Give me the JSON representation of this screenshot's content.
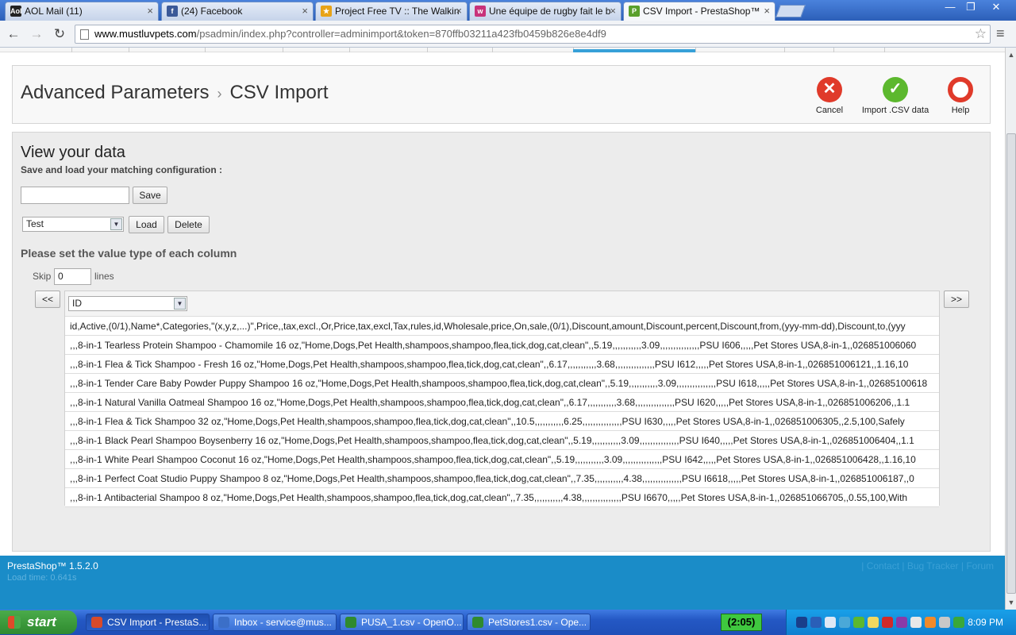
{
  "browser": {
    "tabs": [
      {
        "title": "AOL Mail (11)",
        "favicon": "aol-icon",
        "color": "#222222",
        "glyph": "Aol"
      },
      {
        "title": "(24) Facebook",
        "favicon": "facebook-icon",
        "color": "#3b5998",
        "glyph": "f"
      },
      {
        "title": "Project Free TV :: The Walkin",
        "favicon": "projectfreetv-icon",
        "color": "#e8a317",
        "glyph": "★"
      },
      {
        "title": "Une équipe de rugby fait le b",
        "favicon": "wizz-icon",
        "color": "#c8327a",
        "glyph": "w"
      },
      {
        "title": "CSV Import - PrestaShop™",
        "favicon": "prestashop-icon",
        "color": "#5aa02c",
        "glyph": "P"
      }
    ],
    "url_domain": "www.mustluvpets.com",
    "url_path": "/psadmin/index.php?controller=adminimport&token=870ffb03211a423fb0459b826e8e4df9"
  },
  "header": {
    "breadcrumb_parent": "Advanced Parameters",
    "breadcrumb_current": "CSV Import",
    "cancel_label": "Cancel",
    "import_label": "Import .CSV data",
    "help_label": "Help"
  },
  "content": {
    "title": "View your data",
    "save_config_label": "Save and load your matching configuration :",
    "save_button": "Save",
    "config_selected": "Test",
    "load_button": "Load",
    "delete_button": "Delete",
    "section_title": "Please set the value type of each column",
    "skip_label": "Skip",
    "skip_value": "0",
    "lines_label": "lines",
    "prev_button": "<<",
    "next_button": ">>",
    "column_type": "ID",
    "rows": [
      "id,Active,(0/1),Name*,Categories,\"(x,y,z,...)\",Price,,tax,excl.,Or,Price,tax,excl,Tax,rules,id,Wholesale,price,On,sale,(0/1),Discount,amount,Discount,percent,Discount,from,(yyy-mm-dd),Discount,to,(yyy",
      ",,,8-in-1 Tearless Protein Shampoo - Chamomile 16 oz,\"Home,Dogs,Pet Health,shampoos,shampoo,flea,tick,dog,cat,clean\",,5.19,,,,,,,,,,,3.09,,,,,,,,,,,,,,,PSU I606,,,,,Pet Stores USA,8-in-1,,026851006060",
      ",,,8-in-1 Flea & Tick Shampoo - Fresh 16 oz,\"Home,Dogs,Pet Health,shampoos,shampoo,flea,tick,dog,cat,clean\",,6.17,,,,,,,,,,,3.68,,,,,,,,,,,,,,,PSU I612,,,,,Pet Stores USA,8-in-1,,026851006121,,1.16,10",
      ",,,8-in-1 Tender Care Baby Powder Puppy Shampoo 16 oz,\"Home,Dogs,Pet Health,shampoos,shampoo,flea,tick,dog,cat,clean\",,5.19,,,,,,,,,,,3.09,,,,,,,,,,,,,,,PSU I618,,,,,Pet Stores USA,8-in-1,,02685100618",
      ",,,8-in-1 Natural Vanilla Oatmeal Shampoo 16 oz,\"Home,Dogs,Pet Health,shampoos,shampoo,flea,tick,dog,cat,clean\",,6.17,,,,,,,,,,,3.68,,,,,,,,,,,,,,,PSU I620,,,,,Pet Stores USA,8-in-1,,026851006206,,1.1",
      ",,,8-in-1 Flea & Tick Shampoo 32 oz,\"Home,Dogs,Pet Health,shampoos,shampoo,flea,tick,dog,cat,clean\",,10.5,,,,,,,,,,,6.25,,,,,,,,,,,,,,,PSU I630,,,,,Pet Stores USA,8-in-1,,026851006305,,2.5,100,Safely",
      ",,,8-in-1 Black Pearl Shampoo Boysenberry 16 oz,\"Home,Dogs,Pet Health,shampoos,shampoo,flea,tick,dog,cat,clean\",,5.19,,,,,,,,,,,3.09,,,,,,,,,,,,,,,PSU I640,,,,,Pet Stores USA,8-in-1,,026851006404,,1.1",
      ",,,8-in-1 White Pearl Shampoo Coconut 16 oz,\"Home,Dogs,Pet Health,shampoos,shampoo,flea,tick,dog,cat,clean\",,5.19,,,,,,,,,,,3.09,,,,,,,,,,,,,,,PSU I642,,,,,Pet Stores USA,8-in-1,,026851006428,,1.16,10",
      ",,,8-in-1 Perfect Coat Studio Puppy Shampoo 8 oz,\"Home,Dogs,Pet Health,shampoos,shampoo,flea,tick,dog,cat,clean\",,7.35,,,,,,,,,,,4.38,,,,,,,,,,,,,,,PSU I6618,,,,,Pet Stores USA,8-in-1,,026851006187,,0",
      ",,,8-in-1 Antibacterial Shampoo 8 oz,\"Home,Dogs,Pet Health,shampoos,shampoo,flea,tick,dog,cat,clean\",,7.35,,,,,,,,,,,4.38,,,,,,,,,,,,,,,PSU I6670,,,,,Pet Stores USA,8-in-1,,026851066705,,0.55,100,With"
    ]
  },
  "footer": {
    "version": "PrestaShop™ 1.5.2.0",
    "load_time": "Load time: 0.641s",
    "links": "| Contact | Bug Tracker | Forum"
  },
  "taskbar": {
    "start_label": "start",
    "tasks": [
      {
        "label": "CSV Import - PrestaS...",
        "icon": "chrome-icon",
        "color": "#d84a2a"
      },
      {
        "label": "Inbox - service@mus...",
        "icon": "thunderbird-icon",
        "color": "#3b6fc8"
      },
      {
        "label": "PUSA_1.csv - OpenO...",
        "icon": "spreadsheet-icon",
        "color": "#2f8a2f"
      },
      {
        "label": "PetStores1.csv - Ope...",
        "icon": "spreadsheet-icon",
        "color": "#2f8a2f"
      }
    ],
    "timer": "(2:05)",
    "clock": "8:09 PM"
  }
}
